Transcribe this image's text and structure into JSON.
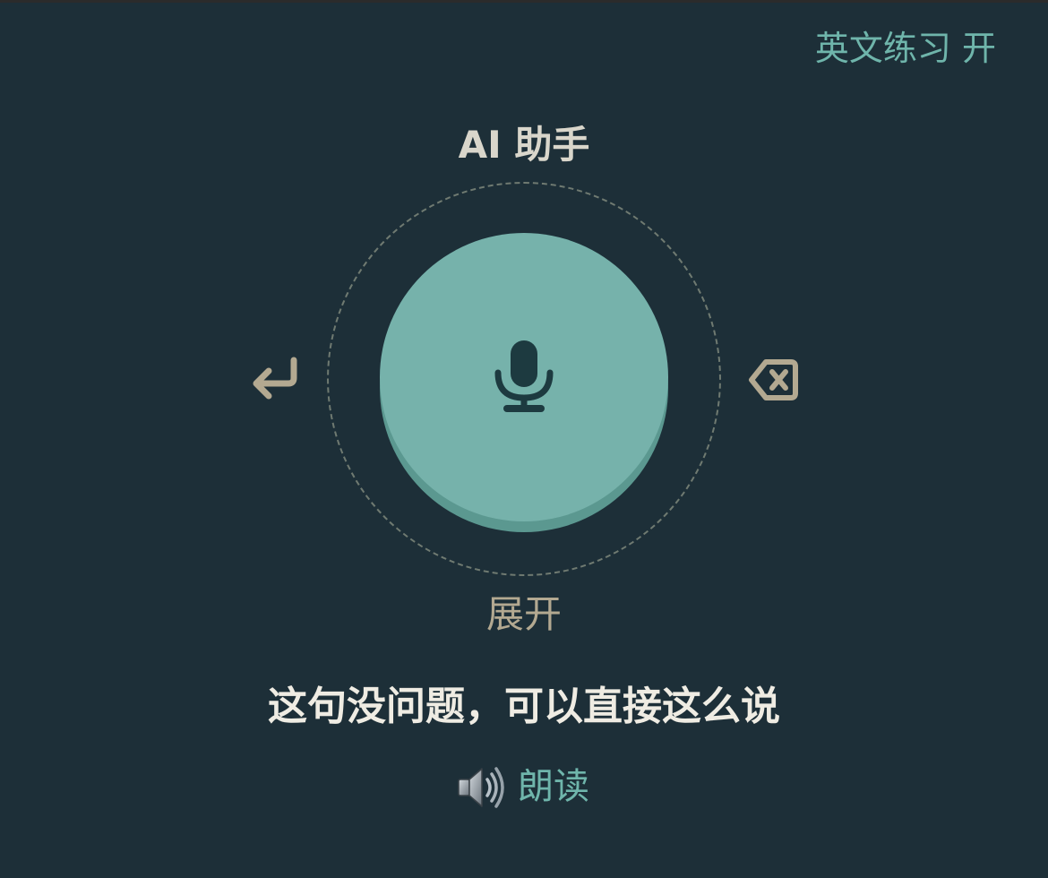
{
  "header": {
    "practice_toggle_label": "英文练习 开"
  },
  "assistant": {
    "title": "AI 助手",
    "expand_label": "展开"
  },
  "controls": {
    "mic_icon": "microphone-icon",
    "enter_icon": "return-arrow-icon",
    "delete_icon": "backspace-icon"
  },
  "feedback": {
    "text": "这句没问题，可以直接这么说",
    "read_aloud_label": "朗读",
    "speaker_icon": "speaker-icon"
  },
  "colors": {
    "background": "#1d2f38",
    "accent_teal": "#76b2ab",
    "accent_text_teal": "#6fb5ab",
    "muted_tan": "#b3a991",
    "title_text": "#d9d6cb",
    "body_text": "#efece3"
  }
}
